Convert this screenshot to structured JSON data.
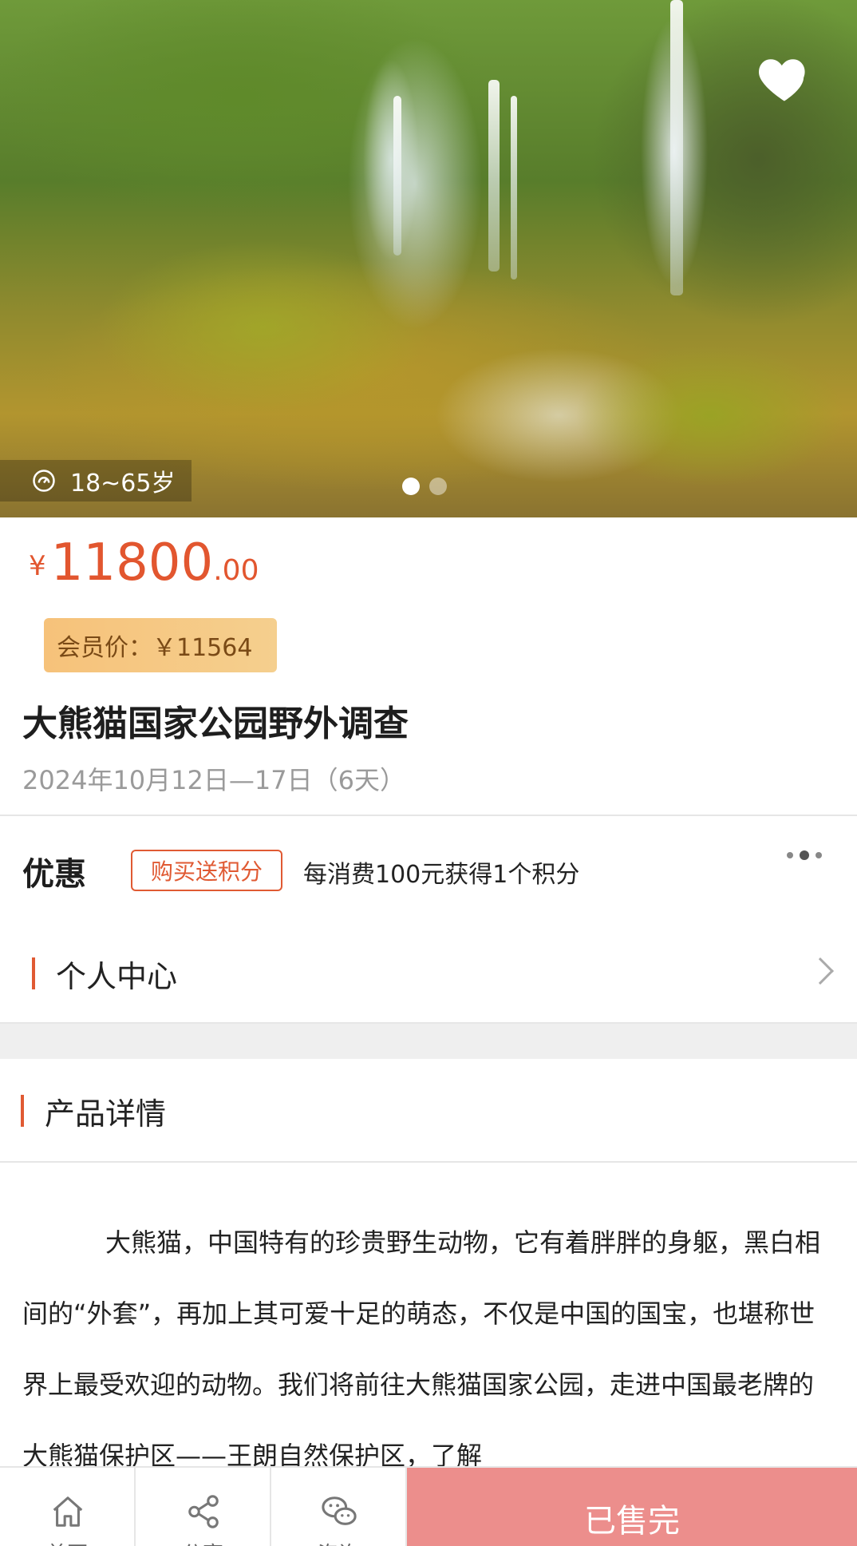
{
  "hero": {
    "age_range": "18~65岁",
    "favorite_icon": "heart-icon",
    "age_icon": "gauge-icon",
    "carousel": {
      "total": 2,
      "active": 1
    }
  },
  "price": {
    "currency": "¥",
    "integer": "11800",
    "decimal": ".00"
  },
  "member_price": "会员价：￥11564",
  "title": "大熊猫国家公园野外调查",
  "dates": "2024年10月12日—17日（6天）",
  "promo": {
    "label": "优惠",
    "tag": "购买送积分",
    "description": "每消费100元获得1个积分",
    "more_icon": "more-dots-icon"
  },
  "personal_center": {
    "label": "个人中心",
    "chevron_icon": "chevron-right-icon"
  },
  "product_details": {
    "label": "产品详情",
    "body": "大熊猫，中国特有的珍贵野生动物，它有着胖胖的身躯，黑白相间的“外套”，再加上其可爱十足的萌态，不仅是中国的国宝，也堪称世界上最受欢迎的动物。我们将前往大熊猫国家公园，走进中国最老牌的大熊猫保护区——王朗自然保护区，了解"
  },
  "bottom_bar": {
    "home_label": "首页",
    "share_label": "分享",
    "consult_label": "咨询",
    "soldout_label": "已售完"
  },
  "colors": {
    "accent": "#e05a33",
    "price": "#e2562f",
    "member_bg": "#f6c27a",
    "soldout_bg": "#ec8e8c"
  }
}
